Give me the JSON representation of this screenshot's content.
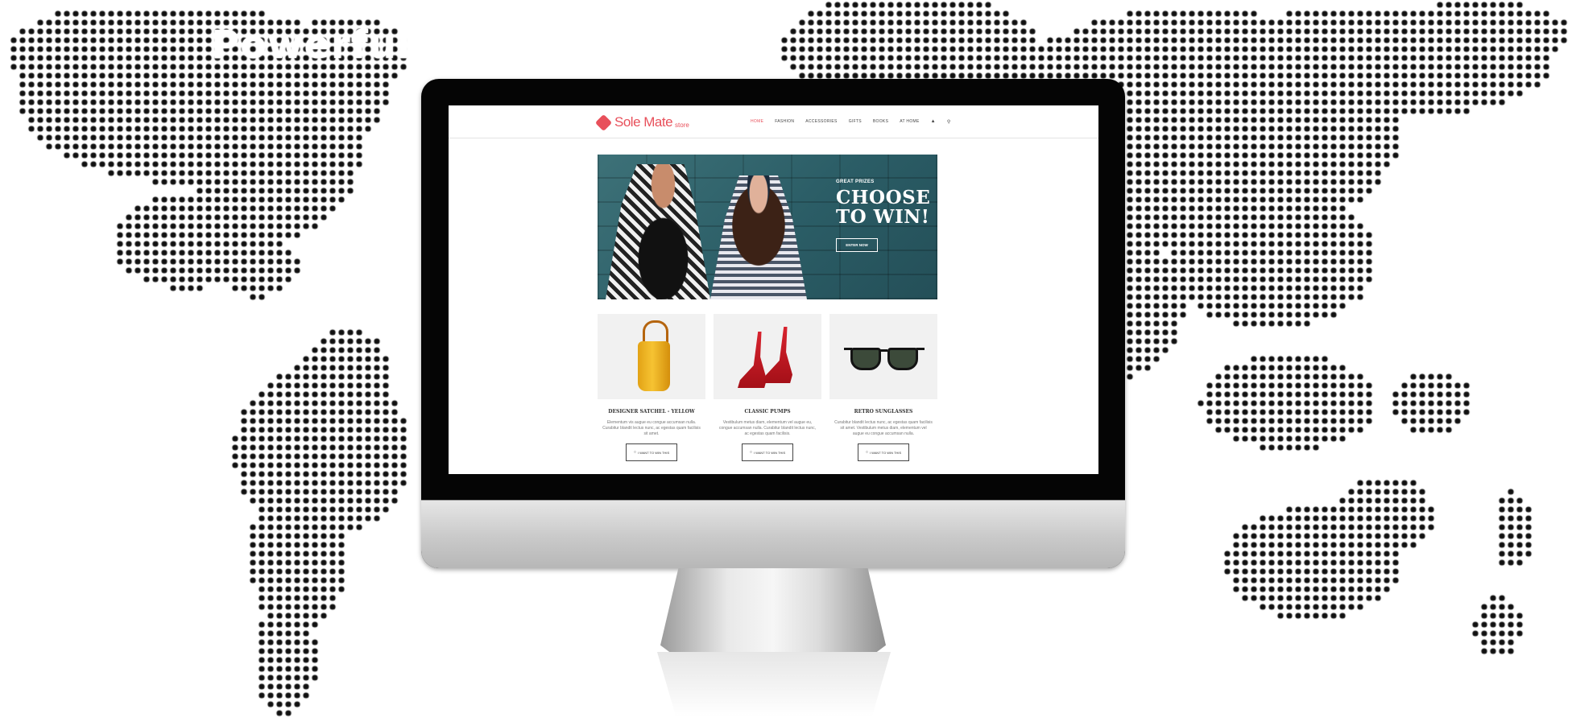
{
  "overlay": {
    "title": "Powerful Interface"
  },
  "site": {
    "logo": {
      "name": "Sole Mate",
      "sub": "store",
      "icon": "tag-icon"
    },
    "nav": [
      {
        "label": "HOME",
        "active": true
      },
      {
        "label": "FASHION"
      },
      {
        "label": "ACCESSORIES"
      },
      {
        "label": "GIFTS"
      },
      {
        "label": "BOOKS"
      },
      {
        "label": "AT HOME"
      }
    ],
    "nav_icons": [
      "user-icon",
      "search-icon"
    ],
    "accent": "#e8505b"
  },
  "hero": {
    "eyebrow": "GREAT PRIZES",
    "title": "CHOOSE TO WIN!",
    "cta": "ENTER NOW"
  },
  "products": [
    {
      "name": "DESIGNER SATCHEL - YELLOW",
      "desc": "Elementum vis augue eu congue accumsan nulla. Curabitur blandit lectus nunc, ac egestas quam facilisis sit amet.",
      "button": "I WANT TO WIN THIS"
    },
    {
      "name": "CLASSIC PUMPS",
      "desc": "Vestibulum metus diam, elementum vel augue eu, congue accumsan nulla. Curabitur blandit lectus nunc, ac egestas quam facilisis.",
      "button": "I WANT TO WIN THIS"
    },
    {
      "name": "RETRO SUNGLASSES",
      "desc": "Curabitur blandit lectus nunc, ac egestas quam facilisis sit amet. Vestibulum metus diam, elementum vel augue eu congue accumsan nulla.",
      "button": "I WANT TO WIN THIS"
    }
  ]
}
